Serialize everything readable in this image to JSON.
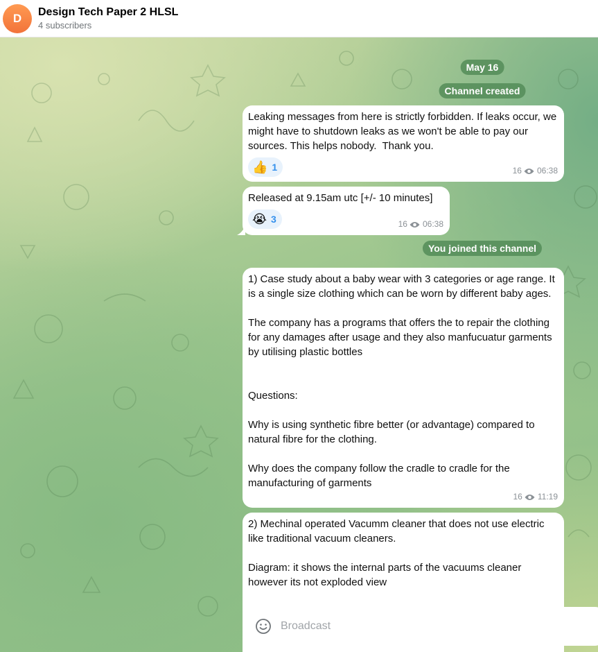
{
  "header": {
    "avatar_letter": "D",
    "title": "Design Tech Paper 2 HLSL",
    "subtitle": "4 subscribers"
  },
  "service": {
    "date": "May 16",
    "created": "Channel created",
    "joined": "You joined this channel"
  },
  "messages": [
    {
      "text": "Leaking messages from here is strictly forbidden. If leaks occur, we might have to shutdown leaks as we won't be able to pay our sources. This helps nobody.  Thank you.",
      "reaction_emoji": "👍",
      "reaction_count": "1",
      "views": "16",
      "time": "06:38"
    },
    {
      "text": "Released at 9.15am utc [+/- 10 minutes]",
      "reaction_emoji": "😭",
      "reaction_count": "3",
      "views": "16",
      "time": "06:38"
    },
    {
      "text": "1) Case study about a baby wear with 3 categories or age range. It is a single size clothing which can be worn by different baby ages.\n\nThe company has a programs that offers the to repair the clothing for any damages after usage and they also manfucuatur garments by utilising plastic bottles\n\n\nQuestions:\n\nWhy is using synthetic fibre better (or advantage) compared to natural fibre for the clothing.\n\nWhy does the company follow the cradle to cradle for the manufacturing of garments",
      "views": "16",
      "time": "11:19"
    },
    {
      "text": "2) Mechinal operated Vacumm cleaner that does not use electric like traditional vacuum cleaners.\n\nDiagram: it shows the internal parts of the vacuums cleaner however its not exploded view"
    }
  ],
  "composer": {
    "placeholder": "Broadcast",
    "emoji_icon": "smile-icon"
  },
  "colors": {
    "avatar": "#f2733a",
    "service_badge": "#538c58",
    "reaction_bg": "#e8f2fc",
    "reaction_count": "#3390ec"
  }
}
